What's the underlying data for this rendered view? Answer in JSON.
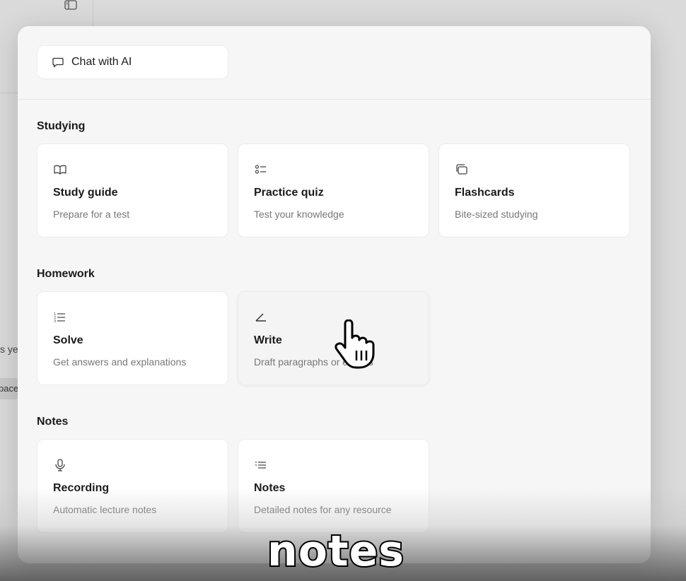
{
  "background": {
    "partial_text_1": "s ye",
    "partial_chip": "pace"
  },
  "chat": {
    "label": "Chat with AI"
  },
  "sections": {
    "studying": {
      "title": "Studying",
      "cards": [
        {
          "title": "Study guide",
          "subtitle": "Prepare for a test",
          "icon": "book-icon"
        },
        {
          "title": "Practice quiz",
          "subtitle": "Test your knowledge",
          "icon": "checklist-icon"
        },
        {
          "title": "Flashcards",
          "subtitle": "Bite-sized studying",
          "icon": "cards-icon"
        }
      ]
    },
    "homework": {
      "title": "Homework",
      "cards": [
        {
          "title": "Solve",
          "subtitle": "Get answers and explanations",
          "icon": "list-icon"
        },
        {
          "title": "Write",
          "subtitle": "Draft paragraphs or essays",
          "icon": "pen-icon"
        }
      ]
    },
    "notes": {
      "title": "Notes",
      "cards": [
        {
          "title": "Recording",
          "subtitle": "Automatic lecture notes",
          "icon": "mic-icon"
        },
        {
          "title": "Notes",
          "subtitle": "Detailed notes for any resource",
          "icon": "notes-icon"
        }
      ]
    }
  },
  "caption": "notes",
  "colors": {
    "modal_bg": "#f6f6f6",
    "card_bg": "#ffffff",
    "text": "#1a1a1a",
    "muted": "#777777"
  }
}
